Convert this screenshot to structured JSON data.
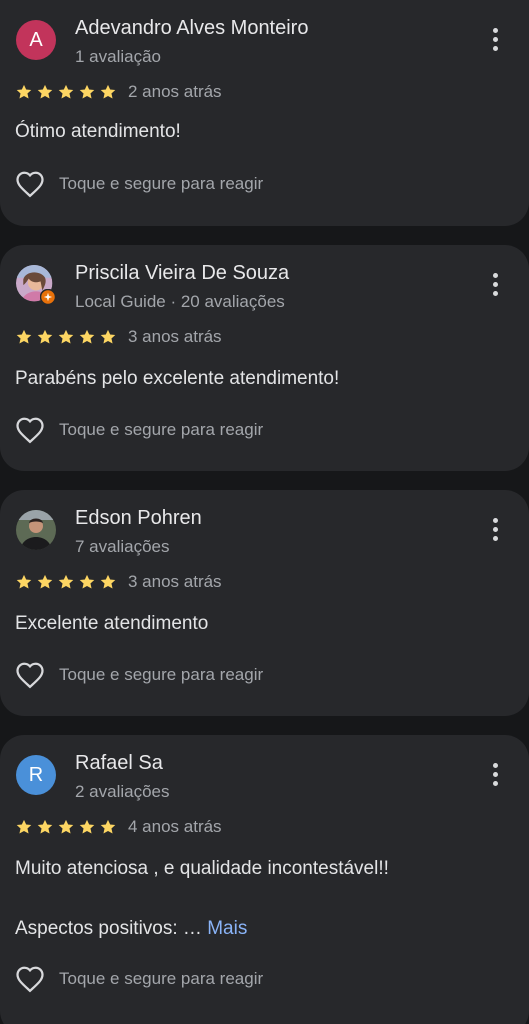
{
  "reviews": [
    {
      "avatar_letter": "A",
      "avatar_color": "#c2345b",
      "name": "Adevandro Alves Monteiro",
      "meta": "1 avaliação",
      "stars": 5,
      "time": "2 anos atrás",
      "text": "Ótimo atendimento!",
      "react_label": "Toque e segure para reagir"
    },
    {
      "avatar_icon": "profile-photo",
      "local_guide_badge": true,
      "name": "Priscila Vieira De Souza",
      "meta": "Local Guide · 20 avaliações",
      "stars": 5,
      "time": "3 anos atrás",
      "text": "Parabéns pelo excelente atendimento!",
      "react_label": "Toque e segure para reagir"
    },
    {
      "avatar_icon": "profile-photo",
      "name": "Edson Pohren",
      "meta": "7 avaliações",
      "stars": 5,
      "time": "3 anos atrás",
      "text": "Excelente atendimento",
      "react_label": "Toque e segure para reagir"
    },
    {
      "avatar_letter": "R",
      "avatar_color": "#4a90d9",
      "name": "Rafael Sa",
      "meta": "2 avaliações",
      "stars": 5,
      "time": "4 anos atrás",
      "text": "Muito atenciosa , e qualidade incontestável!!",
      "text_secondary": "Aspectos positivos: …",
      "more_label": "Mais",
      "react_label": "Toque e segure para reagir"
    }
  ],
  "colors": {
    "background": "#161719",
    "card": "#27282b",
    "star": "#fdd663",
    "link": "#8ab4f8"
  }
}
